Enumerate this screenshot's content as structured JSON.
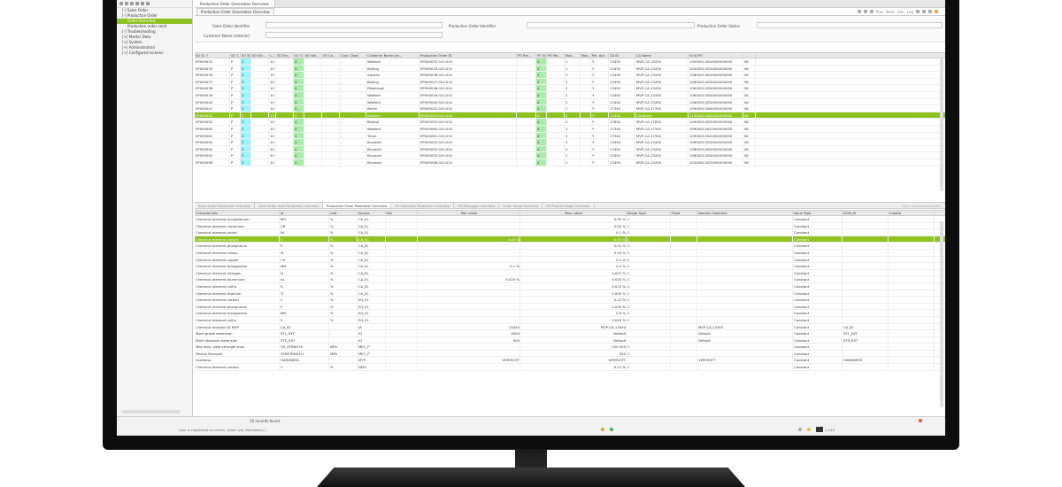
{
  "sidebar": {
    "tree": [
      {
        "label": "[-] Sales Order",
        "level": 1
      },
      {
        "label": "[-] Production Order",
        "level": 1
      },
      {
        "label": "Order Overview",
        "level": 2,
        "selected": true
      },
      {
        "label": "Production order contr",
        "level": 2
      },
      {
        "label": "[-] Troubleshooting",
        "level": 1
      },
      {
        "label": "[+] Master Data",
        "level": 1
      },
      {
        "label": "[+] System",
        "level": 1
      },
      {
        "label": "[+] Administration",
        "level": 1
      },
      {
        "label": "[+] Configured screens",
        "level": 1
      }
    ]
  },
  "main": {
    "tab_title": "Production Order Generation Overview",
    "subtab_title": "Production Order Generation Overview",
    "nav": {
      "prev": "Prev",
      "next": "Next",
      "gen": "Gen",
      "log": "Log"
    }
  },
  "form": {
    "sales_order_identifier_label": "Sales Order Identifier",
    "production_order_identifier_label": "Production Order Identifier",
    "production_order_status_label": "Production Order Status",
    "customer_name_label": "Customer Name (exterior)"
  },
  "top_grid": {
    "columns": [
      "SO ID-↑",
      "SO T...",
      "SO St...",
      "SO Bln...",
      "L...",
      "SO Bln...",
      "SO S...",
      "SO Wo...",
      "SO Ca...",
      "Cust. Class",
      "Customer Name (ex...",
      "Production Order ID",
      "PO Bln...",
      "PO St...",
      "PO Mo...",
      "Max...",
      "Max...",
      "Rel. Aut.",
      "CA ID",
      "CA Name",
      "IQ ID PO",
      ""
    ],
    "rows": [
      [
        "EP000032",
        "P",
        "3",
        "",
        "10",
        "",
        "4",
        "",
        "",
        "-",
        "Watford",
        "EP000032.010.010",
        "",
        "4",
        "",
        "2",
        "",
        "Y",
        "13430",
        "MVP-CA-13430",
        "10000011814000000000",
        "0K"
      ],
      [
        "EP000033",
        "P",
        "3",
        "",
        "10",
        "",
        "4",
        "",
        "",
        "-",
        "Beijing",
        "EP000033.010.010",
        "",
        "4",
        "",
        "2",
        "",
        "Y",
        "13430",
        "MVP-CA-13430",
        "10000011814000000000",
        "0K"
      ],
      [
        "EP000036",
        "P",
        "3",
        "",
        "10",
        "",
        "4",
        "",
        "",
        "-",
        "Aachen",
        "EP000036.010.010",
        "",
        "4",
        "",
        "2",
        "",
        "Y",
        "13430",
        "MVP-CA-13430",
        "10600011814000000000",
        "0K"
      ],
      [
        "EP000037",
        "P",
        "3",
        "",
        "10",
        "",
        "4",
        "",
        "",
        "-",
        "Beijing",
        "EP000037.010.010",
        "",
        "4",
        "",
        "2",
        "",
        "Y",
        "13450",
        "MVP-CA-13450",
        "10600011834000000000",
        "0K"
      ],
      [
        "EP000038",
        "P",
        "3",
        "",
        "10",
        "",
        "4",
        "",
        "",
        "-",
        "Pittsburgh",
        "EP000038.010.010",
        "",
        "4",
        "",
        "2",
        "",
        "Y",
        "13450",
        "MVP-CA-13450",
        "10600011834000000000",
        "0K"
      ],
      [
        "EP000039",
        "P",
        "3",
        "",
        "10",
        "",
        "4",
        "",
        "",
        "-",
        "Watford",
        "EP000039.010.010",
        "",
        "4",
        "",
        "2",
        "",
        "Y",
        "13450",
        "MVP-CA-13450",
        "10600011834000000000",
        "0K"
      ],
      [
        "EP000040",
        "P",
        "3",
        "",
        "10",
        "",
        "4",
        "",
        "",
        "-",
        "Watford",
        "EP000040.010.010",
        "",
        "4",
        "",
        "2",
        "",
        "Y",
        "13450",
        "MVP-CA-13450",
        "10600011834000000000",
        "0K"
      ],
      [
        "EP000041",
        "P",
        "3",
        "",
        "10",
        "",
        "4",
        "",
        "",
        "-",
        "Berlin",
        "EP000041.010.010",
        "",
        "4",
        "",
        "2",
        "",
        "Y",
        "17340",
        "MVP-CA-17340",
        "10900011804000000000",
        "0K"
      ],
      [
        "EP000051",
        "P",
        "3",
        "",
        "10",
        "",
        "4",
        "",
        "",
        "-",
        "Aachen",
        "EP000051.010.010",
        "",
        "4",
        "",
        "2",
        "",
        "Y",
        "13450",
        "CA-Name",
        "11300011804000000000",
        "0K"
      ],
      [
        "EP000052",
        "P",
        "3",
        "",
        "10",
        "",
        "4",
        "",
        "",
        "-",
        "Beijing",
        "EP000052.010.010",
        "",
        "4",
        "",
        "2",
        "",
        "Y",
        "17820",
        "MVP-CA-17820",
        "10900011832000000000",
        "0K"
      ],
      [
        "EP000060",
        "P",
        "3",
        "",
        "10",
        "",
        "4",
        "",
        "",
        "-",
        "Watford",
        "EP000060.010.010",
        "",
        "4",
        "",
        "2",
        "",
        "Y",
        "17340",
        "MVP-CA-17340",
        "10900011841000000000",
        "0K"
      ],
      [
        "EP000061",
        "P",
        "3",
        "",
        "10",
        "",
        "4",
        "",
        "",
        "-",
        "Traun",
        "EP000061.010.010",
        "",
        "4",
        "",
        "2",
        "",
        "Y",
        "17340",
        "MVP-CA-17340",
        "10900011841000000000",
        "0K"
      ],
      [
        "EP000092",
        "P",
        "3",
        "",
        "10",
        "",
        "4",
        "",
        "",
        "-",
        "Brussels",
        "EP000092.010.010",
        "",
        "4",
        "",
        "2",
        "",
        "Y",
        "13450",
        "MVP-CA-13450",
        "10600011834000000000",
        "0K"
      ],
      [
        "EP000092",
        "P",
        "3",
        "",
        "20",
        "",
        "4",
        "",
        "",
        "-",
        "Brussels",
        "EP000092.020.010",
        "",
        "4",
        "",
        "2",
        "",
        "Y",
        "13450",
        "MVP-CA-13450",
        "10600011834000000000",
        "0K"
      ],
      [
        "EP000092",
        "P",
        "3",
        "",
        "30",
        "",
        "4",
        "",
        "",
        "-",
        "Brussels",
        "EP000092.030.010",
        "",
        "4",
        "",
        "2",
        "",
        "Y",
        "13450",
        "MVP-CA-13450",
        "10600011834000000000",
        "0K"
      ],
      [
        "EP000098",
        "P",
        "3",
        "",
        "10",
        "",
        "4",
        "",
        "",
        "-",
        "Brussels",
        "EP000098.010.010",
        "",
        "4",
        "",
        "2",
        "",
        "Y",
        "13450",
        "MVP-CA-13450",
        "10200011870000000000",
        "0K"
      ]
    ]
  },
  "bottom_tabs": [
    "Sales Order Parameter Overview",
    "Sales Order Item Parameter Overview",
    "Production Order Parameter Overview",
    "PO Operation Parameter Overview",
    "PO Messages Overview",
    "Order Visual Overview",
    "PO Product Stage Overview"
  ],
  "bottom_tabs_right": "Open maximized Autom.",
  "bottom_grid": {
    "columns": [
      "Characteristic",
      "Id",
      "Unit",
      "Source-",
      "Pos",
      "Min. value",
      "Max. value",
      "Range Type",
      "Fixed",
      "Domain Comment",
      "Value Type",
      "DOM_ID",
      "Creatio"
    ],
    "rows": [
      [
        "Chemical element molybdenum",
        "MO",
        "%",
        "CA_EL",
        "",
        "",
        "0.05 %",
        "C",
        "",
        "",
        "Constant",
        "",
        ""
      ],
      [
        "Chemical element chromium",
        "CR",
        "%",
        "CA_EL",
        "",
        "",
        "0.05 %",
        "C",
        "",
        "",
        "Constant",
        "",
        ""
      ],
      [
        "Chemical element nickel",
        "NI",
        "%",
        "CA_EL",
        "",
        "",
        "0.1 %",
        "C",
        "",
        "",
        "Constant",
        "",
        ""
      ],
      [
        "Chemical element carbon",
        "C",
        "%",
        "CA_EL",
        "",
        "0.03 %",
        "0.05 %",
        "C",
        "",
        "",
        "Constant",
        "",
        ""
      ],
      [
        "Chemical element phosphorus",
        "P",
        "%",
        "CA_EL",
        "",
        "",
        "0.02 %",
        "C",
        "",
        "",
        "Constant",
        "",
        ""
      ],
      [
        "Chemical element silicon",
        "SI",
        "%",
        "CA_EL",
        "",
        "",
        "0.03 %",
        "C",
        "",
        "",
        "Constant",
        "",
        ""
      ],
      [
        "Chemical element copper",
        "CU",
        "%",
        "CA_EL",
        "",
        "",
        "0.1 %",
        "C",
        "",
        "",
        "Constant",
        "",
        ""
      ],
      [
        "Chemical element manganese",
        "MN",
        "%",
        "CA_EL",
        "",
        "0.1 %",
        "0.2 %",
        "C",
        "",
        "",
        "Constant",
        "",
        ""
      ],
      [
        "Chemical element nitrogen",
        "N",
        "%",
        "CA_EL",
        "",
        "",
        "0.007 %",
        "C",
        "",
        "",
        "Constant",
        "",
        ""
      ],
      [
        "Chemical element aluminium",
        "AL",
        "%",
        "CA_EL",
        "",
        "0.025 %",
        "0.035 %",
        "C",
        "",
        "",
        "Constant",
        "",
        ""
      ],
      [
        "Chemical element sulfur",
        "S",
        "%",
        "CA_EL",
        "",
        "",
        "0.015 %",
        "C",
        "",
        "",
        "Constant",
        "",
        ""
      ],
      [
        "Chemical element titanium",
        "TI",
        "%",
        "CA_EL",
        "",
        "",
        "0.005 %",
        "C",
        "",
        "",
        "Constant",
        "",
        ""
      ],
      [
        "Chemical element carbon",
        "C",
        "%",
        "EQ_EL",
        "",
        "",
        "0.12 %",
        "C",
        "",
        "",
        "Constant",
        "",
        ""
      ],
      [
        "Chemical element phosphorus",
        "P",
        "%",
        "EQ_EL",
        "",
        "",
        "0.045 %",
        "C",
        "",
        "",
        "Constant",
        "",
        ""
      ],
      [
        "Chemical element manganese",
        "MN",
        "%",
        "EQ_EL",
        "",
        "",
        "0.6 %",
        "C",
        "",
        "",
        "Constant",
        "",
        ""
      ],
      [
        "Chemical element sulfur",
        "S",
        "%",
        "EQ_EL",
        "",
        "",
        "0.045 %",
        "C",
        "",
        "",
        "Constant",
        "",
        ""
      ],
      [
        "Chemical analysis ID MVP",
        "CA_ID",
        "",
        "IA",
        "",
        "13450",
        "MVP-CA-13450",
        "",
        "",
        "MVP-CA-13450",
        "Constant",
        "CA_ID",
        ""
      ],
      [
        "Steel grade extension",
        "STL_EXT",
        "-",
        "IQ",
        "",
        "0000",
        "Default",
        "",
        "",
        "Default",
        "Constant",
        "STL_EXT",
        ""
      ],
      [
        "Steel standard extension",
        "STS_EXT",
        "",
        "IQ",
        "",
        "000",
        "Default",
        "",
        "",
        "Default",
        "Constant",
        "STS_EXT",
        ""
      ],
      [
        "Test max. yield strength max",
        "YD_STRNGTH",
        "MPA",
        "MEC_P",
        "",
        "",
        "120 300",
        "C",
        "",
        "",
        "Constant",
        "",
        ""
      ],
      [
        "Tensile Strength",
        "TENSTRNGTH",
        "MPA",
        "MEC_P",
        "",
        "",
        "320",
        "C",
        "",
        "",
        "Constant",
        "",
        ""
      ],
      [
        "hardness",
        "HARDNESS",
        "",
        "MTP",
        "",
        "VERYSOFT",
        "VERYSOFT",
        "",
        "",
        "VERYSOFT",
        "Constant",
        "HARDNESS",
        ""
      ],
      [
        "Chemical element carbon",
        "C",
        "%",
        "DEM",
        "",
        "",
        "0.12 %",
        "C",
        "",
        "",
        "Constant",
        "",
        ""
      ]
    ]
  },
  "status": {
    "records": "16 records found.",
    "user_line": "User is registered to screen. (User: yst, Mandatory: )",
    "zoom": "1.24G"
  },
  "colors": {
    "selection": "#8dc21f",
    "cyan_col": "#9ef4ff",
    "green_col": "#a8eea8"
  }
}
